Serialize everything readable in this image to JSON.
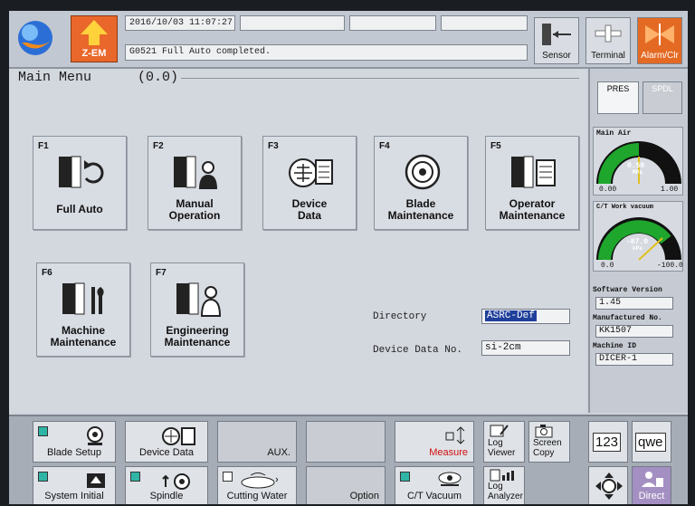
{
  "header": {
    "logo_icon": "globe-logo-icon",
    "zem_label": "Z-EM",
    "datetime": "2016/10/03 11:07:27",
    "message": "G0521 Full Auto completed.",
    "sensor_label": "Sensor",
    "terminal_label": "Terminal",
    "alarm_label": "Alarm/Clr",
    "alarm_color": "#e46a23"
  },
  "main": {
    "title": "Main Menu",
    "coords": "(0.0)",
    "functions": [
      {
        "key": "F1",
        "line1": "",
        "line2": "Full Auto",
        "icon": "full-auto-icon"
      },
      {
        "key": "F2",
        "line1": "Manual",
        "line2": "Operation",
        "icon": "manual-operation-icon"
      },
      {
        "key": "F3",
        "line1": "Device",
        "line2": "Data",
        "icon": "device-data-icon"
      },
      {
        "key": "F4",
        "line1": "Blade",
        "line2": "Maintenance",
        "icon": "blade-icon"
      },
      {
        "key": "F5",
        "line1": "Operator",
        "line2": "Maintenance",
        "icon": "operator-maintenance-icon"
      },
      {
        "key": "F6",
        "line1": "Machine",
        "line2": "Maintenance",
        "icon": "machine-maintenance-icon"
      },
      {
        "key": "F7",
        "line1": "Engineering",
        "line2": "Maintenance",
        "icon": "engineering-maintenance-icon"
      }
    ],
    "directory_label": "Directory",
    "directory_value": "ASRC-Def",
    "device_no_label": "Device Data No.",
    "device_no_value": "si-2cm"
  },
  "right": {
    "tab_pres": "PRES",
    "tab_spdl": "SPDL",
    "gauge1": {
      "title": "Main Air",
      "value": "0.50",
      "unit": "MPa",
      "min": "0.00",
      "max": "1.00"
    },
    "gauge2": {
      "title": "C/T Work vacuum",
      "value": "-87.0",
      "unit": "kPa",
      "min": "0.0",
      "max": "-100.0"
    },
    "software_label": "Software Version",
    "software_value": "1.45",
    "manufactured_label": "Manufactured No.",
    "manufactured_value": "KK1507",
    "machine_id_label": "Machine ID",
    "machine_id_value": "DICER-1",
    "gauge_color": "#1fa62c"
  },
  "bottom": {
    "blade_setup": "Blade Setup",
    "device_data": "Device Data",
    "aux": "AUX.",
    "measure": "Measure",
    "measure_color": "#d01010",
    "log_viewer_1": "Log",
    "log_viewer_2": "Viewer",
    "screen_copy_1": "Screen",
    "screen_copy_2": "Copy",
    "key_123": "123",
    "key_qwe": "qwe",
    "system_initial": "System Initial",
    "spindle": "Spindle",
    "cutting_water": "Cutting Water",
    "option": "Option",
    "ct_vacuum": "C/T Vacuum",
    "log_analyzer_1": "Log",
    "log_analyzer_2": "Analyzer",
    "direct": "Direct",
    "direct_color": "#a48fc2"
  }
}
